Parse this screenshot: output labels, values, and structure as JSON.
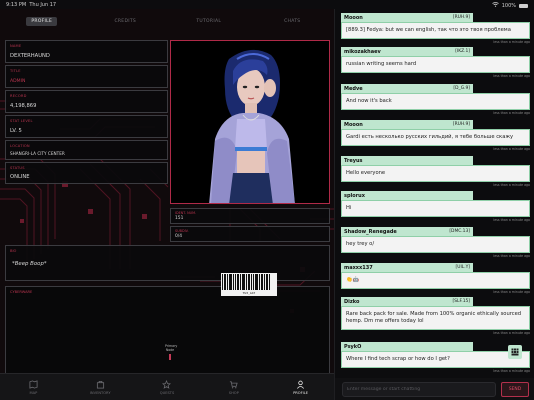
{
  "status_bar": {
    "time": "9:13 PM",
    "date": "Thu Jun 17",
    "battery": "100%"
  },
  "tabs": [
    {
      "label": "PROFILE",
      "active": true
    },
    {
      "label": "CREDITS",
      "active": false
    },
    {
      "label": "TUTORIAL",
      "active": false
    },
    {
      "label": "CHATS",
      "active": false
    }
  ],
  "profile": {
    "name": {
      "label": "NAME",
      "value": "DEXTERHAUND"
    },
    "title": {
      "label": "TITLE",
      "value": "ADMIN"
    },
    "record": {
      "label": "RECORD",
      "value": "4,198,869"
    },
    "level": {
      "label": "STAT LEVEL",
      "value": "LV. 5"
    },
    "location": {
      "label": "LOCATION",
      "value": "SHANGRI-LA CITY CENTER"
    },
    "status": {
      "label": "STATUS",
      "value": "ONLINE"
    },
    "ident": {
      "label": "IDENT. NUM.",
      "value": "151"
    },
    "uid": {
      "label": "SUBDIV.",
      "value": "0/4"
    },
    "bio": {
      "label": "BIO",
      "value": "*Beep Boop*"
    },
    "component": {
      "label": "CYBERWARE",
      "pin_label": "Primary Node"
    },
    "barcode": "TU3_A47"
  },
  "nav": [
    {
      "label": "MAP",
      "icon": "map-icon",
      "active": false
    },
    {
      "label": "INVENTORY",
      "icon": "inventory-icon",
      "active": false
    },
    {
      "label": "QUESTS",
      "icon": "quests-icon",
      "active": false
    },
    {
      "label": "SHOP",
      "icon": "shop-icon",
      "active": false
    },
    {
      "label": "PROFILE",
      "icon": "profile-icon",
      "active": true
    }
  ],
  "chat": {
    "messages": [
      {
        "name": "Mooon",
        "faction": "[RUH.9]",
        "text": "[889.3] Fedya: but we can english, так что это твоя проблема",
        "ts": "less than a minute ago"
      },
      {
        "name": "mikozakhaev",
        "faction": "[IKZ.1]",
        "text": "russian writing seems hard",
        "ts": "less than a minute ago"
      },
      {
        "name": "Medve",
        "faction": "[D_G.9]",
        "text": "And now it's back",
        "ts": "less than a minute ago"
      },
      {
        "name": "Mooon",
        "faction": "[RUH.9]",
        "text": "Gardi есть несколько русских гильдий, я тебе больше скажу",
        "ts": "less than a minute ago"
      },
      {
        "name": "Treyus",
        "faction": "",
        "text": "Hello everyone",
        "ts": "less than a minute ago"
      },
      {
        "name": "splorux",
        "faction": "",
        "text": "Hi",
        "ts": "less than a minute ago"
      },
      {
        "name": "Shadow_Renegade",
        "faction": "[DMC.13]",
        "text": "hey trey o/",
        "ts": "less than a minute ago"
      },
      {
        "name": "maxxx137",
        "faction": "[UIL.Y]",
        "text": "👏🤖",
        "ts": "less than a minute ago"
      },
      {
        "name": "Dizko",
        "faction": "[SLF.15]",
        "text": "Rare back pack for sale. Made from 100% organic ethically sourced hemp. Dm me offers today lol",
        "ts": "less than a minute ago"
      },
      {
        "name": "PsykO",
        "faction": "",
        "text": "Where I find tech scrap or how do I get?",
        "ts": "less than a minute ago"
      }
    ],
    "input_placeholder": "Enter message or start chatting",
    "send_label": "SEND"
  },
  "colors": {
    "accent": "#b8344e",
    "chat_header": "#bfe6cf",
    "chat_body": "#f3f3f3"
  }
}
